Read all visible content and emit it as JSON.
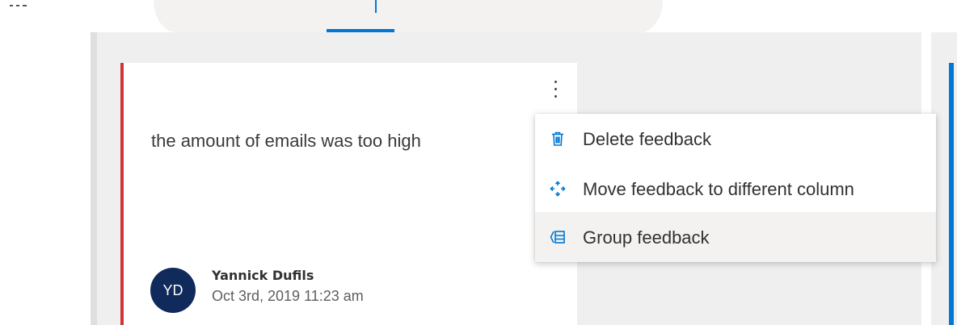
{
  "theme": {
    "accent": "#0078d4",
    "card_accent": "#d13438",
    "avatar_bg": "#0f2a5b"
  },
  "card": {
    "text": "the amount of emails was too high",
    "author": {
      "initials": "YD",
      "name": "Yannick Dufils",
      "timestamp": "Oct 3rd, 2019 11:23 am"
    },
    "more_icon": "more-vertical-icon"
  },
  "context_menu": {
    "items": [
      {
        "label": "Delete feedback",
        "icon": "trash-icon"
      },
      {
        "label": "Move feedback to different column",
        "icon": "move-icon"
      },
      {
        "label": "Group feedback",
        "icon": "group-icon"
      }
    ]
  }
}
